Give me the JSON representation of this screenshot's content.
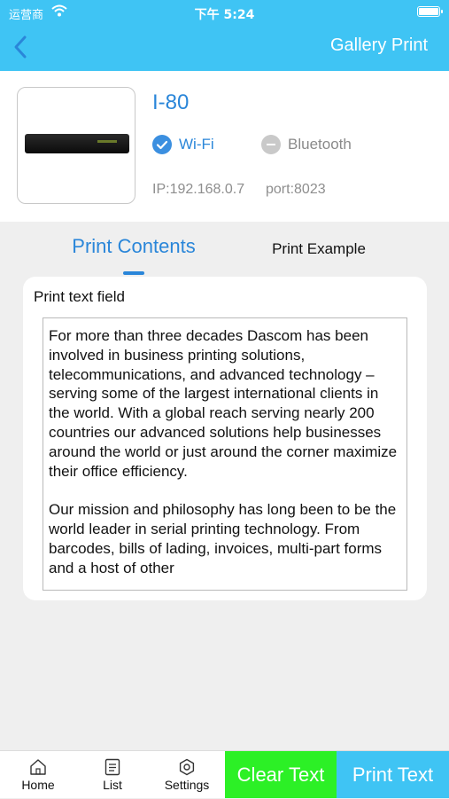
{
  "status_bar": {
    "carrier": "运营商",
    "time": "下午 5:24"
  },
  "header": {
    "title": "Gallery Print"
  },
  "device": {
    "name": "I-80",
    "wifi_label": "Wi-Fi",
    "bluetooth_label": "Bluetooth",
    "ip": "IP:192.168.0.7",
    "port": "port:8023",
    "wifi_selected": true,
    "bluetooth_selected": false
  },
  "tabs": [
    {
      "label": "Print Contents",
      "active": true
    },
    {
      "label": "Print Example",
      "active": false
    }
  ],
  "print_field": {
    "label": "Print text field",
    "text": "For more than three decades Dascom has been involved in business printing solutions, telecommunications, and advanced technology – serving some of the largest international clients in the world. With a global reach serving nearly 200 countries our advanced solutions help businesses around the world or just around the corner maximize their office efficiency.\n\nOur mission and philosophy has long been to be the world leader in serial printing technology. From barcodes, bills of lading, invoices, multi-part forms and a host of other"
  },
  "bottom_nav": [
    {
      "label": "Home",
      "icon": "home-icon"
    },
    {
      "label": "List",
      "icon": "list-icon"
    },
    {
      "label": "Settings",
      "icon": "settings-icon"
    }
  ],
  "actions": {
    "clear_label": "Clear Text",
    "print_label": "Print Text"
  },
  "colors": {
    "header": "#3fc4f4",
    "accent": "#2a86d9",
    "clear_button": "#2cf026",
    "print_button": "#3fc4f4"
  }
}
